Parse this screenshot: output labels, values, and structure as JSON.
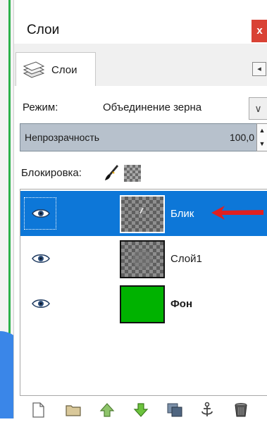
{
  "window": {
    "title": "Слои",
    "close_glyph": "x"
  },
  "tab": {
    "label": "Слои",
    "icon": "layers-stack-icon",
    "menu_glyph": "◂"
  },
  "mode": {
    "label": "Режим:",
    "value": "Объединение зерна",
    "arrow_glyph": "∨"
  },
  "opacity": {
    "label": "Непрозрачность",
    "value": "100,0",
    "spin_up": "▲",
    "spin_down": "▼"
  },
  "lock": {
    "label": "Блокировка:",
    "icons": [
      "brush-icon",
      "alpha-checker-icon"
    ]
  },
  "layers": [
    {
      "name": "Блик",
      "visible": true,
      "selected": true,
      "thumbnail": "transparent-checker",
      "bold": false
    },
    {
      "name": "Слой1",
      "visible": true,
      "selected": false,
      "thumbnail": "transparent-checker",
      "bold": false
    },
    {
      "name": "Фон",
      "visible": true,
      "selected": false,
      "thumbnail": "solid-green",
      "bold": true
    }
  ],
  "toolbar_icons": [
    "new-layer-icon",
    "new-group-icon",
    "raise-layer-icon",
    "lower-layer-icon",
    "duplicate-layer-icon",
    "anchor-layer-icon",
    "delete-layer-icon"
  ],
  "colors": {
    "selection": "#0d77d8",
    "close": "#d94235",
    "opacity_bar": "#b7c1cc",
    "green_layer": "#00b200",
    "annotation_arrow": "#e02020",
    "frame_accent": "#2cb24a",
    "desktop_blue": "#3a86e8"
  }
}
